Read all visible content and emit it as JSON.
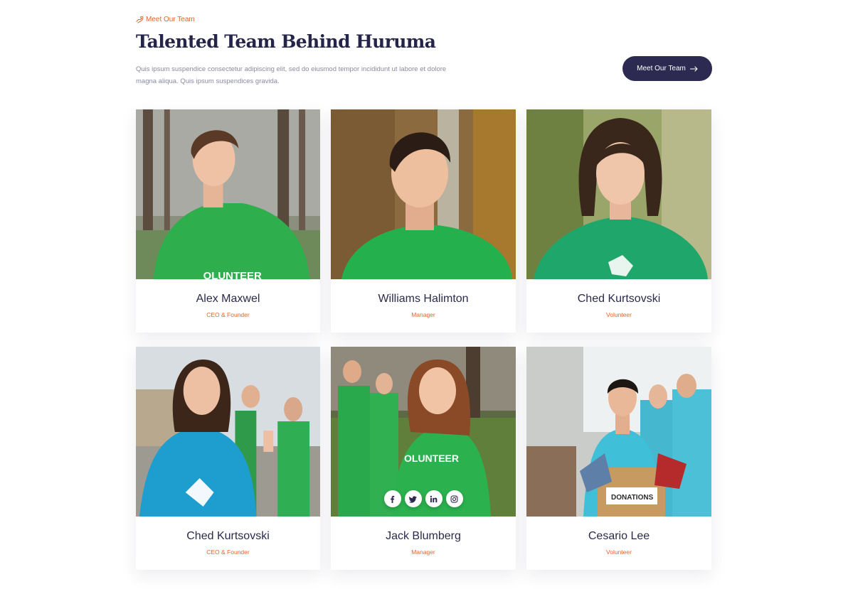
{
  "header": {
    "eyebrow": "Meet Our Team",
    "title": "Talented Team Behind Huruma",
    "description": "Quis ipsum suspendice consectetur adipiscing elit, sed do eiusmod tempor incididunt ut labore et dolore magna aliqua. Quis ipsum suspendices gravida.",
    "cta_label": "Meet Our Team"
  },
  "colors": {
    "accent": "#e8622c",
    "primary": "#2d2a52",
    "heading": "#25254a",
    "body_text": "#8a8aa0"
  },
  "team": [
    {
      "name": "Alex Maxwel",
      "role": "CEO & Founder"
    },
    {
      "name": "Williams Halimton",
      "role": "Manager"
    },
    {
      "name": "Ched Kurtsovski",
      "role": "Volunteer"
    },
    {
      "name": "Ched Kurtsovski",
      "role": "CEO & Founder"
    },
    {
      "name": "Jack Blumberg",
      "role": "Manager"
    },
    {
      "name": "Cesario Lee",
      "role": "Volunteer"
    }
  ],
  "social_icons": [
    "facebook-icon",
    "twitter-icon",
    "linkedin-icon",
    "instagram-icon"
  ],
  "photo_labels": {
    "shirt_text_1": "OLUNTEER",
    "shirt_text_5": "OLUNTEER",
    "donation_box": "DONATIONS"
  }
}
